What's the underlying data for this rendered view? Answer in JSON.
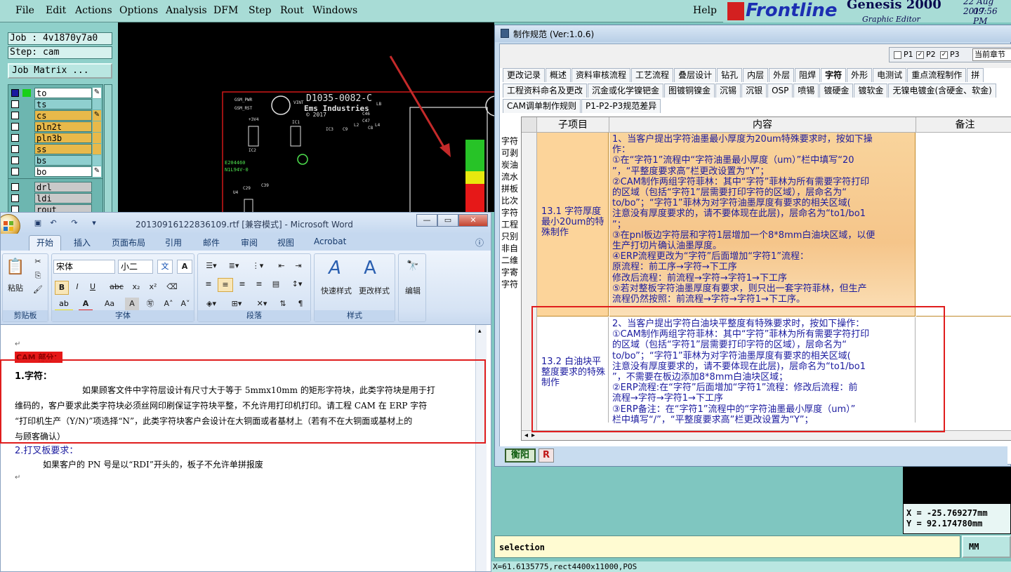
{
  "genesis": {
    "menu": [
      "File",
      "Edit",
      "Actions",
      "Options",
      "Analysis",
      "DFM",
      "Step",
      "Rout",
      "Windows"
    ],
    "help": "Help",
    "brand": "Frontline",
    "app_title": "Genesis 2000",
    "app_subtitle": "Graphic Editor",
    "date": "22 Aug 2017",
    "time": "09:56 PM",
    "job": "Job : 4v1870y7a0",
    "step": "Step: cam",
    "job_matrix": "Job Matrix ...",
    "layers": [
      {
        "name": "to",
        "color": "#ffffff",
        "edit": "✎"
      },
      {
        "name": "ts",
        "color": "#8fcfcf",
        "edit": ""
      },
      {
        "name": "cs",
        "color": "#e8b94a",
        "edit": "✎"
      },
      {
        "name": "pln2t",
        "color": "#e8b94a",
        "edit": ""
      },
      {
        "name": "pln3b",
        "color": "#e8b94a",
        "edit": ""
      },
      {
        "name": "ss",
        "color": "#e8b94a",
        "edit": ""
      },
      {
        "name": "bs",
        "color": "#8fcfcf",
        "edit": ""
      },
      {
        "name": "bo",
        "color": "#ffffff",
        "edit": "✎"
      }
    ],
    "layers2": [
      {
        "name": "drl",
        "color": "#c9c9c9"
      },
      {
        "name": "ldi",
        "color": "#c9c9c9"
      },
      {
        "name": "rout",
        "color": "#c9c9c9"
      }
    ],
    "cad": {
      "board_title": "D1035-0082-C",
      "company": "Ems Industries",
      "year": "© 2017",
      "labels": [
        "GSM_PWR",
        "GSM_RST",
        "VINT",
        "+3V4",
        "IC1",
        "IC2",
        "IC3",
        "C46",
        "C47",
        "C9",
        "L2",
        "L4",
        "LB",
        "C8",
        "E204460",
        "N1L94V-0",
        "C39",
        "C29",
        "U4"
      ]
    },
    "coords": {
      "x": "X = -25.769277mm",
      "y": "Y = 92.174780mm"
    },
    "selection": "selection",
    "unit": "MM",
    "status": "X=61.6135775,rect4400x11000,POS"
  },
  "spec": {
    "title": "制作规范 (Ver:1.0.6)",
    "p_options": [
      {
        "label": "P1",
        "checked": false
      },
      {
        "label": "P2",
        "checked": true
      },
      {
        "label": "P3",
        "checked": true
      }
    ],
    "chapter": "当前章节",
    "tabs_row1": [
      "更改记录",
      "概述",
      "资料审核流程",
      "工艺流程",
      "叠层设计",
      "钻孔",
      "内层",
      "外层",
      "阻焊",
      "字符",
      "外形",
      "电测试",
      "重点流程制作",
      "拼"
    ],
    "active_tab": "字符",
    "tabs_row2": [
      "工程资料命名及更改",
      "沉金或化学镍钯金",
      "图镀铜镍金",
      "沉锡",
      "沉银",
      "OSP",
      "喷锡",
      "镀硬金",
      "镀软金",
      "无镍电镀金(含硬金、软金)"
    ],
    "tabs_row3": [
      "CAM调单制作规则",
      "P1-P2-P3规范差异"
    ],
    "left_list": [
      "字符",
      "可剥",
      "炭油",
      "流水",
      "拼板",
      "比次",
      "字符",
      "工程",
      "只别",
      "非自",
      "二维",
      "字寄",
      "字符"
    ],
    "headers": {
      "sub": "子项目",
      "content": "内容",
      "note": "备注"
    },
    "rows": [
      {
        "sub": "13.1 字符厚度最小20um的特殊制作",
        "lines": [
          "1、当客户提出字符油墨最小厚度为20um特殊要求时，按如下操",
          "作：",
          "①在“字符1”流程中“字符油墨最小厚度（um）”栏中填写“20",
          "”，“平整度要求高”栏更改设置为“Y”；",
          "②CAM制作两组字符菲林：其中“字符”菲林为所有需要字符打印",
          "的区域（包括“字符1”层需要打印字符的区域），层命名为“",
          "to/bo”；“字符1”菲林为对字符油墨厚度有要求的相关区域(",
          "注意没有厚度要求的，请不要体现在此层)，层命名为“to1/bo1",
          "”；",
          "③在pnl板边字符层和字符1层增加一个8*8mm白油块区域，以便",
          "生产打切片确认油墨厚度。",
          "④ERP流程更改为“字符”后面增加“字符1”流程：",
          "原流程：前工序→字符→下工序",
          "修改后流程：前流程→字符→字符1→下工序",
          "⑤若对整板字符油墨厚度有要求，则只出一套字符菲林，但生产",
          "流程仍然按照：前流程→字符→字符1→下工序。"
        ]
      },
      {
        "sub": "13.2 白油块平整度要求的特殊制作",
        "lines": [
          "2、当客户提出字符白油块平整度有特殊要求时，按如下操作：",
          "①CAM制作两组字符菲林：其中“字符”菲林为所有需要字符打印",
          "的区域（包括“字符1”层需要打印字符的区域），层命名为“",
          "to/bo”；“字符1”菲林为对字符油墨厚度有要求的相关区域(",
          "注意没有厚度要求的，请不要体现在此层)，层命名为“to1/bo1",
          "”，不需要在板边添加8*8mm白油块区域；",
          "②ERP流程:在“字符”后面增加“字符1”流程：修改后流程：前",
          "流程→字符→字符1→下工序",
          "③ERP备注：在“字符1”流程中的“字符油墨最小厚度（um）”",
          "栏中填写“/”，“平整度要求高”栏更改设置为“Y”；"
        ]
      }
    ],
    "btn_hengyang": "衡阳",
    "btn_r": "R"
  },
  "word": {
    "caption": "20130916122836109.rtf [兼容模式] - Microsoft Word",
    "tabs": [
      "开始",
      "插入",
      "页面布局",
      "引用",
      "邮件",
      "审阅",
      "视图",
      "Acrobat"
    ],
    "font_name": "宋体",
    "font_size": "小二",
    "groups": [
      "剪贴板",
      "字体",
      "段落",
      "样式",
      "编辑"
    ],
    "paste": "粘贴",
    "quick_style": "快速样式",
    "change_style": "更改样式",
    "edit": "编辑",
    "doc": {
      "heading": "CAM 部分：",
      "item1_title": "1.字符：",
      "item1_l1": "如果顾客文件中字符层设计有尺寸大于等于 5mmx10mm 的矩形字符块，此类字符块是用于打",
      "item1_l2": "维码的，客户要求此类字符块必须丝网印刷保证字符块平整，不允许用打印机打印。请工程 CAM 在 ERP 字符",
      "item1_l3": "“打印机生产（Y/N)”项选择“N”，此类字符块客户会设计在大铜面或者基材上（若有不在大铜面或基材上的",
      "item1_l4": "与顾客确认）",
      "item2_title": "2.打叉板要求：",
      "item2_l1": "如果客户的 PN 号是以“RDI”开头的，板子不允许单拼报废"
    }
  },
  "colors": {
    "red_annotation": "#e01d1d",
    "genesis_bg": "#7fc6c0",
    "spec_content_fill": "#f5c58a",
    "text_blue": "#1b1b9f"
  }
}
